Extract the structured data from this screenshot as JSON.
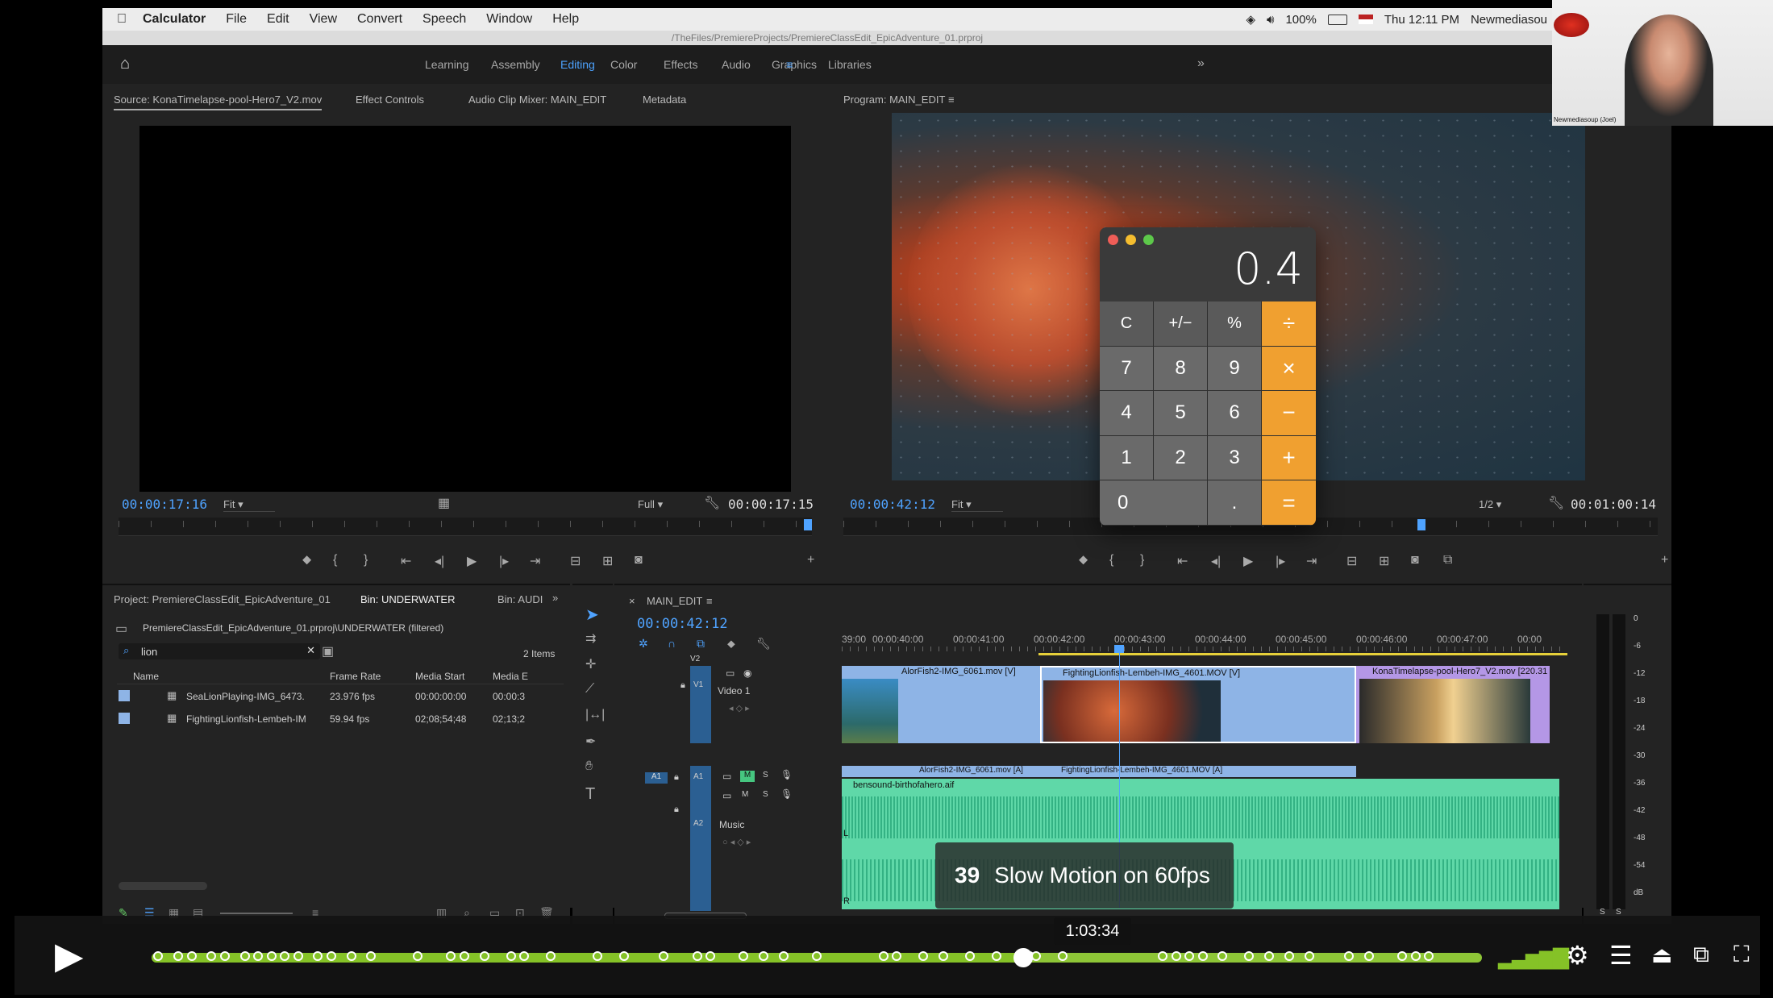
{
  "menubar": {
    "app": "Calculator",
    "items": [
      "File",
      "Edit",
      "View",
      "Convert",
      "Speech",
      "Window",
      "Help"
    ],
    "battery": "100%",
    "clock": "Thu 12:11 PM",
    "user": "Newmediasou"
  },
  "path": "/TheFiles/PremiereProjects/PremiereClassEdit_EpicAdventure_01.prproj",
  "workspace": {
    "tabs": [
      {
        "label": "Learning",
        "active": false
      },
      {
        "label": "Assembly",
        "active": false
      },
      {
        "label": "Editing",
        "active": true
      },
      {
        "label": "Color",
        "active": false
      },
      {
        "label": "Effects",
        "active": false
      },
      {
        "label": "Audio",
        "active": false
      },
      {
        "label": "Graphics",
        "active": false
      },
      {
        "label": "Libraries",
        "active": false
      }
    ]
  },
  "source": {
    "tabs": [
      "Source: KonaTimelapse-pool-Hero7_V2.mov",
      "Effect Controls",
      "Audio Clip Mixer: MAIN_EDIT",
      "Metadata"
    ],
    "timecode": "00:00:17:16",
    "fit": "Fit",
    "quality": "Full",
    "duration": "00:00:17:15"
  },
  "program": {
    "title": "Program: MAIN_EDIT",
    "timecode": "00:00:42:12",
    "fit": "Fit",
    "quality": "1/2",
    "duration": "00:01:00:14"
  },
  "calculator": {
    "display": "0.4",
    "keys": [
      {
        "label": "C",
        "type": "top"
      },
      {
        "label": "+/−",
        "type": "top"
      },
      {
        "label": "%",
        "type": "top"
      },
      {
        "label": "÷",
        "type": "op"
      },
      {
        "label": "7",
        "type": "num"
      },
      {
        "label": "8",
        "type": "num"
      },
      {
        "label": "9",
        "type": "num"
      },
      {
        "label": "×",
        "type": "op"
      },
      {
        "label": "4",
        "type": "num"
      },
      {
        "label": "5",
        "type": "num"
      },
      {
        "label": "6",
        "type": "num"
      },
      {
        "label": "−",
        "type": "op"
      },
      {
        "label": "1",
        "type": "num"
      },
      {
        "label": "2",
        "type": "num"
      },
      {
        "label": "3",
        "type": "num"
      },
      {
        "label": "+",
        "type": "op"
      },
      {
        "label": "0",
        "type": "zero"
      },
      {
        "label": ".",
        "type": "num"
      },
      {
        "label": "=",
        "type": "op"
      }
    ]
  },
  "project": {
    "tabs": [
      "Project: PremiereClassEdit_EpicAdventure_01",
      "Bin: UNDERWATER",
      "Bin: AUDI"
    ],
    "path": "PremiereClassEdit_EpicAdventure_01.prproj\\UNDERWATER (filtered)",
    "search": "lion",
    "count": "2 Items",
    "columns": [
      "Name",
      "Frame Rate",
      "Media Start",
      "Media E"
    ],
    "rows": [
      {
        "name": "SeaLionPlaying-IMG_6473.",
        "fps": "23.976 fps",
        "start": "00:00:00:00",
        "end": "00:00:3"
      },
      {
        "name": "FightingLionfish-Lembeh-IM",
        "fps": "59.94 fps",
        "start": "02;08;54;48",
        "end": "02;13;2"
      }
    ]
  },
  "timeline": {
    "title": "MAIN_EDIT",
    "timecode": "00:00:42:12",
    "ruler": [
      "39:00",
      "00:00:40:00",
      "00:00:41:00",
      "00:00:42:00",
      "00:00:43:00",
      "00:00:44:00",
      "00:00:45:00",
      "00:00:46:00",
      "00:00:47:00",
      "00:00"
    ],
    "tracks": {
      "v2": "V2",
      "v1": "V1",
      "video1": "Video 1",
      "a1": "A1",
      "a2": "A2",
      "music": "Music",
      "m": "M",
      "s": "S"
    },
    "clips": {
      "v1a": "AlorFish2-IMG_6061.mov [V]",
      "v1b": "FightingLionfish-Lembeh-IMG_4601.MOV [V]",
      "v1c": "KonaTimelapse-pool-Hero7_V2.mov [220.31",
      "a1a": "AlorFish2-IMG_6061.mov [A]",
      "a1b": "FightingLionfish-Lembeh-IMG_4601.MOV [A]",
      "a2": "bensound-birthofahero.aif"
    },
    "audio_markers": {
      "l": "L",
      "r": "R"
    }
  },
  "meter": {
    "scale": [
      "0",
      "-6",
      "-12",
      "-18",
      "-24",
      "-30",
      "-36",
      "-42",
      "-48",
      "-54",
      "dB"
    ],
    "s": "S"
  },
  "webcam": {
    "name": "Newmediasoup (Joel)"
  },
  "player": {
    "chapter_number": "39",
    "chapter_title": "Slow Motion on 60fps",
    "hover_time": "1:03:34",
    "progress": 0.655,
    "markers": [
      0.005,
      0.02,
      0.03,
      0.045,
      0.055,
      0.07,
      0.08,
      0.09,
      0.1,
      0.11,
      0.125,
      0.135,
      0.15,
      0.165,
      0.2,
      0.225,
      0.235,
      0.25,
      0.27,
      0.28,
      0.3,
      0.335,
      0.355,
      0.385,
      0.41,
      0.42,
      0.445,
      0.46,
      0.475,
      0.5,
      0.55,
      0.56,
      0.58,
      0.595,
      0.615,
      0.635,
      0.66,
      0.665,
      0.685,
      0.76,
      0.77,
      0.78,
      0.79,
      0.805,
      0.825,
      0.84,
      0.855,
      0.87,
      0.9,
      0.915,
      0.94,
      0.95,
      0.96
    ]
  }
}
